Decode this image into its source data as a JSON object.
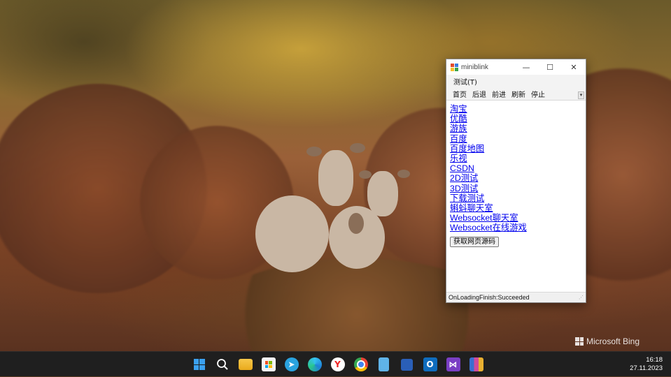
{
  "window": {
    "title": "miniblink",
    "controls": {
      "minimize": "—",
      "maximize": "☐",
      "close": "✕"
    },
    "menu": [
      "测试(T)"
    ],
    "toolbar": [
      "首页",
      "后退",
      "前进",
      "刷新",
      "停止"
    ],
    "overflow": "▾",
    "links": [
      "淘宝",
      "优酷",
      "游族",
      "百度",
      "百度地图",
      "乐视",
      "CSDN",
      "2D测试",
      "3D测试",
      "下载测试",
      "蝌蚪聊天室",
      "Websocket聊天室",
      "Websocket在线游戏"
    ],
    "button": "获取网页源码",
    "status": "OnLoadingFinish:Succeeded"
  },
  "wallpaper": {
    "watermark": "Microsoft Bing"
  },
  "taskbar": {
    "icons": [
      "start-icon",
      "search-icon",
      "file-explorer-icon",
      "microsoft-store-icon",
      "telegram-icon",
      "edge-icon",
      "yandex-browser-icon",
      "chrome-icon",
      "notepad-icon",
      "save-app-icon",
      "outlook-icon",
      "visual-studio-icon",
      "winrar-icon"
    ],
    "time": "16:18",
    "date": "27.11.2023"
  }
}
